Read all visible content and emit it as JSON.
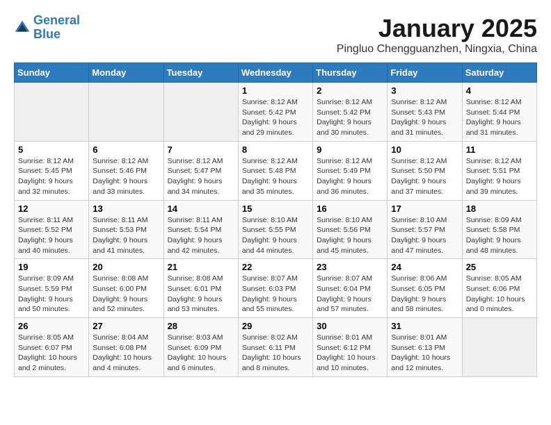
{
  "header": {
    "logo_line1": "General",
    "logo_line2": "Blue",
    "title": "January 2025",
    "subtitle": "Pingluo Chengguanzhen, Ningxia, China"
  },
  "weekdays": [
    "Sunday",
    "Monday",
    "Tuesday",
    "Wednesday",
    "Thursday",
    "Friday",
    "Saturday"
  ],
  "weeks": [
    [
      {
        "day": "",
        "sunrise": "",
        "sunset": "",
        "daylight": "",
        "empty": true
      },
      {
        "day": "",
        "sunrise": "",
        "sunset": "",
        "daylight": "",
        "empty": true
      },
      {
        "day": "",
        "sunrise": "",
        "sunset": "",
        "daylight": "",
        "empty": true
      },
      {
        "day": "1",
        "sunrise": "Sunrise: 8:12 AM",
        "sunset": "Sunset: 5:42 PM",
        "daylight": "Daylight: 9 hours and 29 minutes."
      },
      {
        "day": "2",
        "sunrise": "Sunrise: 8:12 AM",
        "sunset": "Sunset: 5:42 PM",
        "daylight": "Daylight: 9 hours and 30 minutes."
      },
      {
        "day": "3",
        "sunrise": "Sunrise: 8:12 AM",
        "sunset": "Sunset: 5:43 PM",
        "daylight": "Daylight: 9 hours and 31 minutes."
      },
      {
        "day": "4",
        "sunrise": "Sunrise: 8:12 AM",
        "sunset": "Sunset: 5:44 PM",
        "daylight": "Daylight: 9 hours and 31 minutes."
      }
    ],
    [
      {
        "day": "5",
        "sunrise": "Sunrise: 8:12 AM",
        "sunset": "Sunset: 5:45 PM",
        "daylight": "Daylight: 9 hours and 32 minutes."
      },
      {
        "day": "6",
        "sunrise": "Sunrise: 8:12 AM",
        "sunset": "Sunset: 5:46 PM",
        "daylight": "Daylight: 9 hours and 33 minutes."
      },
      {
        "day": "7",
        "sunrise": "Sunrise: 8:12 AM",
        "sunset": "Sunset: 5:47 PM",
        "daylight": "Daylight: 9 hours and 34 minutes."
      },
      {
        "day": "8",
        "sunrise": "Sunrise: 8:12 AM",
        "sunset": "Sunset: 5:48 PM",
        "daylight": "Daylight: 9 hours and 35 minutes."
      },
      {
        "day": "9",
        "sunrise": "Sunrise: 8:12 AM",
        "sunset": "Sunset: 5:49 PM",
        "daylight": "Daylight: 9 hours and 36 minutes."
      },
      {
        "day": "10",
        "sunrise": "Sunrise: 8:12 AM",
        "sunset": "Sunset: 5:50 PM",
        "daylight": "Daylight: 9 hours and 37 minutes."
      },
      {
        "day": "11",
        "sunrise": "Sunrise: 8:12 AM",
        "sunset": "Sunset: 5:51 PM",
        "daylight": "Daylight: 9 hours and 39 minutes."
      }
    ],
    [
      {
        "day": "12",
        "sunrise": "Sunrise: 8:11 AM",
        "sunset": "Sunset: 5:52 PM",
        "daylight": "Daylight: 9 hours and 40 minutes."
      },
      {
        "day": "13",
        "sunrise": "Sunrise: 8:11 AM",
        "sunset": "Sunset: 5:53 PM",
        "daylight": "Daylight: 9 hours and 41 minutes."
      },
      {
        "day": "14",
        "sunrise": "Sunrise: 8:11 AM",
        "sunset": "Sunset: 5:54 PM",
        "daylight": "Daylight: 9 hours and 42 minutes."
      },
      {
        "day": "15",
        "sunrise": "Sunrise: 8:10 AM",
        "sunset": "Sunset: 5:55 PM",
        "daylight": "Daylight: 9 hours and 44 minutes."
      },
      {
        "day": "16",
        "sunrise": "Sunrise: 8:10 AM",
        "sunset": "Sunset: 5:56 PM",
        "daylight": "Daylight: 9 hours and 45 minutes."
      },
      {
        "day": "17",
        "sunrise": "Sunrise: 8:10 AM",
        "sunset": "Sunset: 5:57 PM",
        "daylight": "Daylight: 9 hours and 47 minutes."
      },
      {
        "day": "18",
        "sunrise": "Sunrise: 8:09 AM",
        "sunset": "Sunset: 5:58 PM",
        "daylight": "Daylight: 9 hours and 48 minutes."
      }
    ],
    [
      {
        "day": "19",
        "sunrise": "Sunrise: 8:09 AM",
        "sunset": "Sunset: 5:59 PM",
        "daylight": "Daylight: 9 hours and 50 minutes."
      },
      {
        "day": "20",
        "sunrise": "Sunrise: 8:08 AM",
        "sunset": "Sunset: 6:00 PM",
        "daylight": "Daylight: 9 hours and 52 minutes."
      },
      {
        "day": "21",
        "sunrise": "Sunrise: 8:08 AM",
        "sunset": "Sunset: 6:01 PM",
        "daylight": "Daylight: 9 hours and 53 minutes."
      },
      {
        "day": "22",
        "sunrise": "Sunrise: 8:07 AM",
        "sunset": "Sunset: 6:03 PM",
        "daylight": "Daylight: 9 hours and 55 minutes."
      },
      {
        "day": "23",
        "sunrise": "Sunrise: 8:07 AM",
        "sunset": "Sunset: 6:04 PM",
        "daylight": "Daylight: 9 hours and 57 minutes."
      },
      {
        "day": "24",
        "sunrise": "Sunrise: 8:06 AM",
        "sunset": "Sunset: 6:05 PM",
        "daylight": "Daylight: 9 hours and 58 minutes."
      },
      {
        "day": "25",
        "sunrise": "Sunrise: 8:05 AM",
        "sunset": "Sunset: 6:06 PM",
        "daylight": "Daylight: 10 hours and 0 minutes."
      }
    ],
    [
      {
        "day": "26",
        "sunrise": "Sunrise: 8:05 AM",
        "sunset": "Sunset: 6:07 PM",
        "daylight": "Daylight: 10 hours and 2 minutes."
      },
      {
        "day": "27",
        "sunrise": "Sunrise: 8:04 AM",
        "sunset": "Sunset: 6:08 PM",
        "daylight": "Daylight: 10 hours and 4 minutes."
      },
      {
        "day": "28",
        "sunrise": "Sunrise: 8:03 AM",
        "sunset": "Sunset: 6:09 PM",
        "daylight": "Daylight: 10 hours and 6 minutes."
      },
      {
        "day": "29",
        "sunrise": "Sunrise: 8:02 AM",
        "sunset": "Sunset: 6:11 PM",
        "daylight": "Daylight: 10 hours and 8 minutes."
      },
      {
        "day": "30",
        "sunrise": "Sunrise: 8:01 AM",
        "sunset": "Sunset: 6:12 PM",
        "daylight": "Daylight: 10 hours and 10 minutes."
      },
      {
        "day": "31",
        "sunrise": "Sunrise: 8:01 AM",
        "sunset": "Sunset: 6:13 PM",
        "daylight": "Daylight: 10 hours and 12 minutes."
      },
      {
        "day": "",
        "sunrise": "",
        "sunset": "",
        "daylight": "",
        "empty": true
      }
    ]
  ]
}
